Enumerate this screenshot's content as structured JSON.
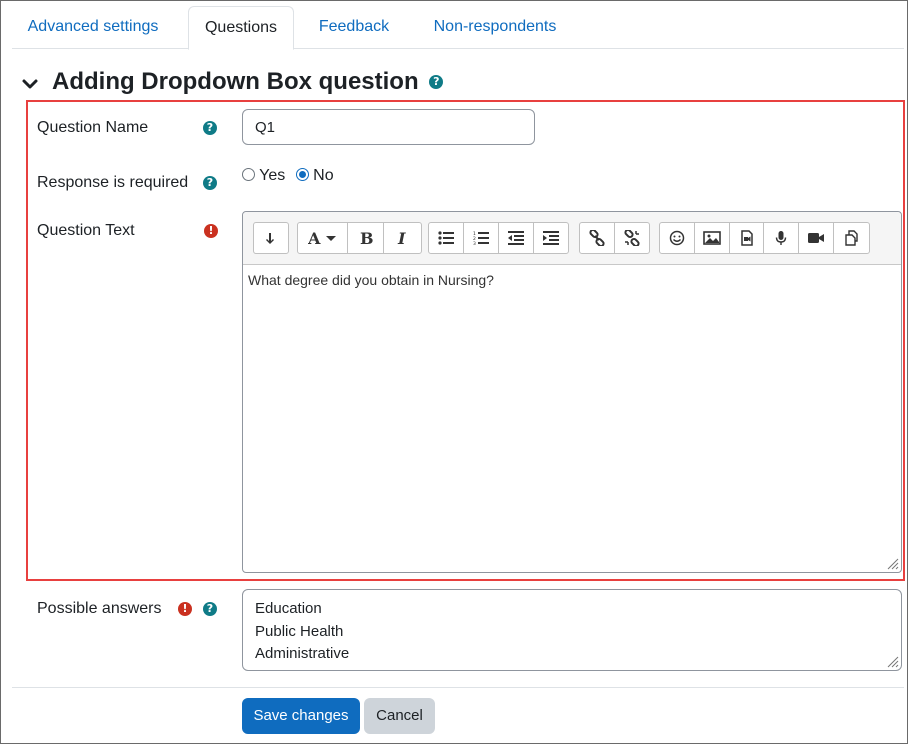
{
  "tabs": [
    {
      "label": "Advanced settings",
      "active": false
    },
    {
      "label": "Questions",
      "active": true
    },
    {
      "label": "Feedback",
      "active": false
    },
    {
      "label": "Non-respondents",
      "active": false
    }
  ],
  "section": {
    "title": "Adding Dropdown Box question"
  },
  "form": {
    "question_name": {
      "label": "Question Name",
      "value": "Q1"
    },
    "response_required": {
      "label": "Response is required",
      "options": [
        "Yes",
        "No"
      ],
      "selected": "No"
    },
    "question_text": {
      "label": "Question Text",
      "content": "What degree did you obtain in Nursing?"
    },
    "possible_answers": {
      "label": "Possible answers",
      "lines": [
        "Education",
        "Public Health",
        "Administrative"
      ]
    }
  },
  "buttons": {
    "save_label": "Save changes",
    "cancel_label": "Cancel"
  },
  "icons": {
    "help": "?",
    "required": "!"
  },
  "colors": {
    "link": "#0f6cbf",
    "primary": "#0f6cbf",
    "help": "#0f7b87",
    "required": "#ca3120",
    "highlight": "#e8403f"
  }
}
